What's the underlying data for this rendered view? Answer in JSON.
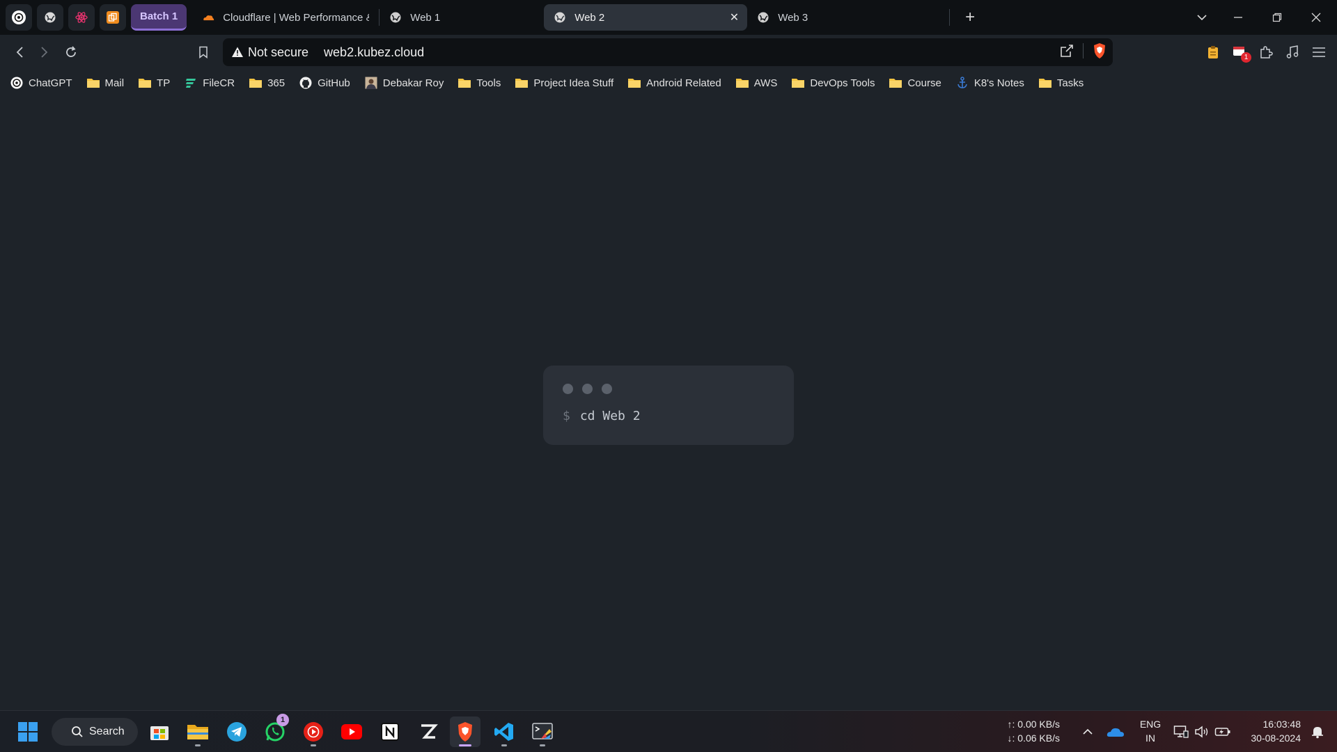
{
  "tabstrip": {
    "pinned": [
      {
        "icon": "chatgpt-icon"
      },
      {
        "icon": "globe-icon"
      },
      {
        "icon": "react-icon"
      },
      {
        "icon": "copy-icon"
      }
    ],
    "group_label": "Batch 1",
    "tabs": [
      {
        "title": "Cloudflare | Web Performance & Se",
        "icon": "cloudflare-icon",
        "active": false
      },
      {
        "title": "Web 1",
        "icon": "globe-icon",
        "active": false
      },
      {
        "title": "Web 2",
        "icon": "globe-icon",
        "active": true
      },
      {
        "title": "Web 3",
        "icon": "globe-icon",
        "active": false
      }
    ],
    "new_tab": "+"
  },
  "toolbar": {
    "security_label": "Not secure",
    "url": "web2.kubez.cloud",
    "badge_count": "1"
  },
  "bookmarks": [
    {
      "label": "ChatGPT",
      "icon": "chatgpt-icon"
    },
    {
      "label": "Mail",
      "icon": "folder-icon"
    },
    {
      "label": "TP",
      "icon": "folder-icon"
    },
    {
      "label": "FileCR",
      "icon": "filecr-icon"
    },
    {
      "label": "365",
      "icon": "folder-icon"
    },
    {
      "label": "GitHub",
      "icon": "github-icon"
    },
    {
      "label": "Debakar Roy",
      "icon": "avatar-icon"
    },
    {
      "label": "Tools",
      "icon": "folder-icon"
    },
    {
      "label": "Project Idea Stuff",
      "icon": "folder-icon"
    },
    {
      "label": "Android Related",
      "icon": "folder-icon"
    },
    {
      "label": "AWS",
      "icon": "folder-icon"
    },
    {
      "label": "DevOps Tools",
      "icon": "folder-icon"
    },
    {
      "label": "Course",
      "icon": "folder-icon"
    },
    {
      "label": "K8's Notes",
      "icon": "anchor-icon"
    },
    {
      "label": "Tasks",
      "icon": "folder-icon"
    }
  ],
  "page": {
    "prompt_symbol": "$",
    "command": "cd Web 2"
  },
  "taskbar": {
    "search_label": "Search",
    "whatsapp_badge": "1",
    "net_up": "↑: 0.00 KB/s",
    "net_down": "↓: 0.06 KB/s",
    "lang": "ENG",
    "region": "IN",
    "time": "16:03:48",
    "date": "30-08-2024"
  },
  "colors": {
    "accent": "#8c6fd4",
    "brave": "#fb542b",
    "folder": "#f5c542"
  }
}
